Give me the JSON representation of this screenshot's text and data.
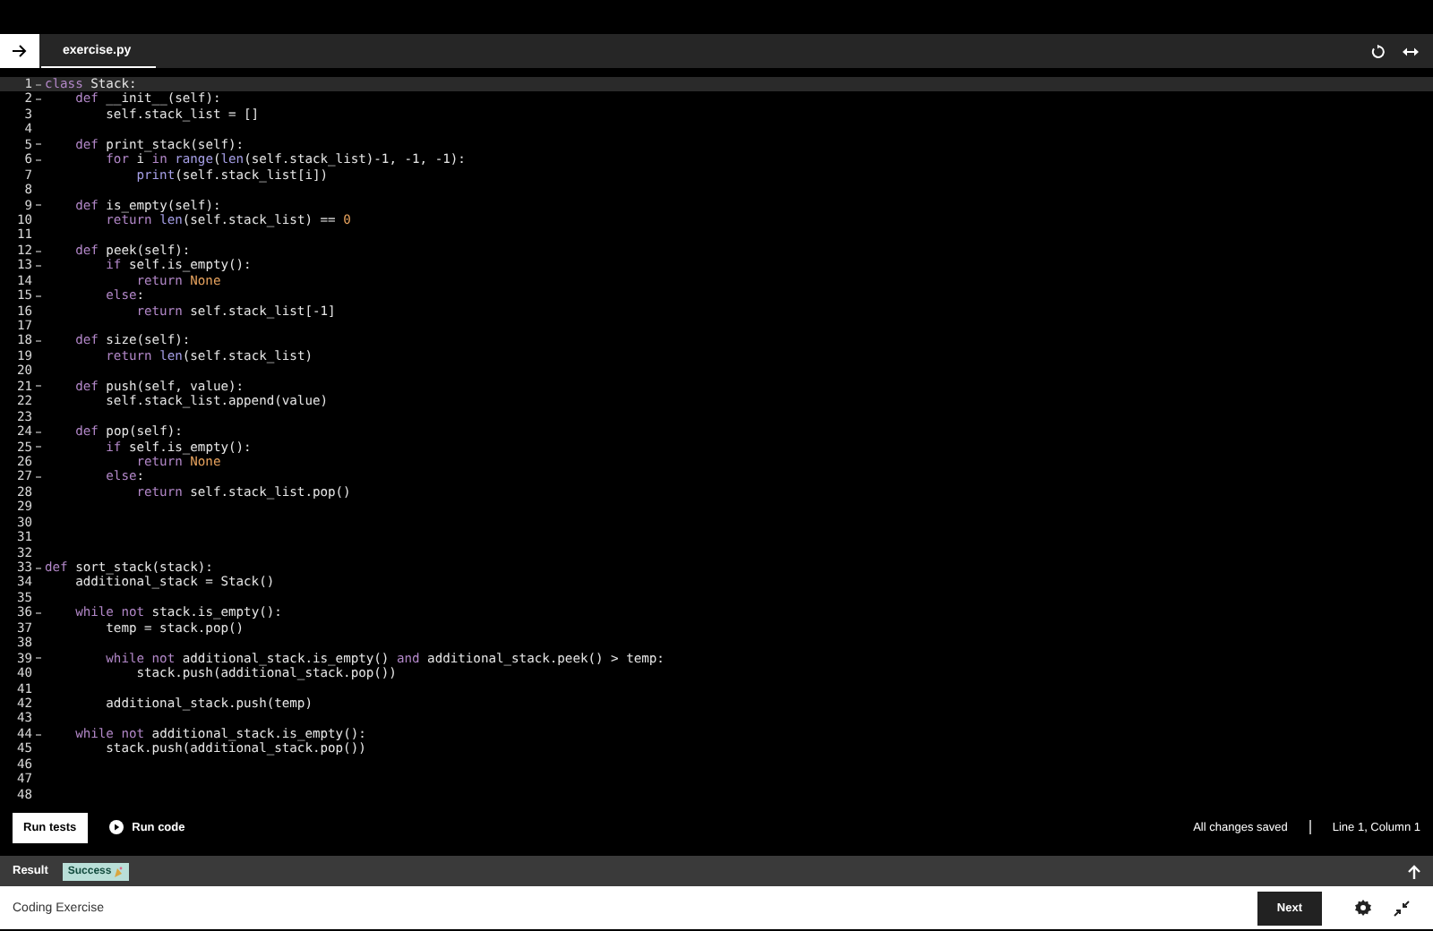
{
  "tab_bar": {
    "file_tab": {
      "label": "exercise.py",
      "selected": true
    }
  },
  "editor": {
    "lines": [
      {
        "number": "1",
        "foldable": true,
        "current": true,
        "tokens": [
          {
            "kind": "keyword",
            "text": "class"
          },
          {
            "kind": "plain",
            "text": " Stack:"
          }
        ]
      },
      {
        "number": "2",
        "foldable": true,
        "current": false,
        "tokens": [
          {
            "kind": "keyword",
            "text": "    def"
          },
          {
            "kind": "plain",
            "text": " __init__(self):"
          }
        ]
      },
      {
        "number": "3",
        "foldable": false,
        "current": false,
        "tokens": [
          {
            "kind": "plain",
            "text": "        self.stack_list = []"
          }
        ]
      },
      {
        "number": "4",
        "foldable": false,
        "current": false
      },
      {
        "number": "5",
        "foldable": true,
        "current": false,
        "tokens": [
          {
            "kind": "keyword",
            "text": "    def"
          },
          {
            "kind": "plain",
            "text": " print_stack(self):"
          }
        ]
      },
      {
        "number": "6",
        "foldable": true,
        "current": false,
        "tokens": [
          {
            "kind": "keyword",
            "text": "        for"
          },
          {
            "kind": "plain",
            "text": " i "
          },
          {
            "kind": "keyword",
            "text": "in"
          },
          {
            "kind": "builtin",
            "text": " range"
          },
          {
            "kind": "plain",
            "text": "("
          },
          {
            "kind": "builtin",
            "text": "len"
          },
          {
            "kind": "plain",
            "text": "(self.stack_list)-1, -1, -1):"
          }
        ]
      },
      {
        "number": "7",
        "foldable": false,
        "current": false,
        "tokens": [
          {
            "kind": "builtin",
            "text": "            print"
          },
          {
            "kind": "plain",
            "text": "(self.stack_list[i])"
          }
        ]
      },
      {
        "number": "8",
        "foldable": false,
        "current": false
      },
      {
        "number": "9",
        "foldable": true,
        "current": false,
        "tokens": [
          {
            "kind": "keyword",
            "text": "    def"
          },
          {
            "kind": "plain",
            "text": " is_empty(self):"
          }
        ]
      },
      {
        "number": "10",
        "foldable": false,
        "current": false,
        "tokens": [
          {
            "kind": "keyword",
            "text": "        return"
          },
          {
            "kind": "builtin",
            "text": " len"
          },
          {
            "kind": "plain",
            "text": "(self.stack_list) == "
          },
          {
            "kind": "constant",
            "text": "0"
          }
        ]
      },
      {
        "number": "11",
        "foldable": false,
        "current": false
      },
      {
        "number": "12",
        "foldable": true,
        "current": false,
        "tokens": [
          {
            "kind": "keyword",
            "text": "    def"
          },
          {
            "kind": "plain",
            "text": " peek(self):"
          }
        ]
      },
      {
        "number": "13",
        "foldable": true,
        "current": false,
        "tokens": [
          {
            "kind": "keyword",
            "text": "        if"
          },
          {
            "kind": "plain",
            "text": " self.is_empty():"
          }
        ]
      },
      {
        "number": "14",
        "foldable": false,
        "current": false,
        "tokens": [
          {
            "kind": "keyword",
            "text": "            return"
          },
          {
            "kind": "constant",
            "text": " None"
          }
        ]
      },
      {
        "number": "15",
        "foldable": true,
        "current": false,
        "tokens": [
          {
            "kind": "keyword",
            "text": "        else"
          },
          {
            "kind": "plain",
            "text": ":"
          }
        ]
      },
      {
        "number": "16",
        "foldable": false,
        "current": false,
        "tokens": [
          {
            "kind": "keyword",
            "text": "            return"
          },
          {
            "kind": "plain",
            "text": " self.stack_list[-1]"
          }
        ]
      },
      {
        "number": "17",
        "foldable": false,
        "current": false
      },
      {
        "number": "18",
        "foldable": true,
        "current": false,
        "tokens": [
          {
            "kind": "keyword",
            "text": "    def"
          },
          {
            "kind": "plain",
            "text": " size(self):"
          }
        ]
      },
      {
        "number": "19",
        "foldable": false,
        "current": false,
        "tokens": [
          {
            "kind": "keyword",
            "text": "        return"
          },
          {
            "kind": "builtin",
            "text": " len"
          },
          {
            "kind": "plain",
            "text": "(self.stack_list)"
          }
        ]
      },
      {
        "number": "20",
        "foldable": false,
        "current": false
      },
      {
        "number": "21",
        "foldable": true,
        "current": false,
        "tokens": [
          {
            "kind": "keyword",
            "text": "    def"
          },
          {
            "kind": "plain",
            "text": " push(self, value):"
          }
        ]
      },
      {
        "number": "22",
        "foldable": false,
        "current": false,
        "tokens": [
          {
            "kind": "plain",
            "text": "        self.stack_list.append(value)"
          }
        ]
      },
      {
        "number": "23",
        "foldable": false,
        "current": false
      },
      {
        "number": "24",
        "foldable": true,
        "current": false,
        "tokens": [
          {
            "kind": "keyword",
            "text": "    def"
          },
          {
            "kind": "plain",
            "text": " pop(self):"
          }
        ]
      },
      {
        "number": "25",
        "foldable": true,
        "current": false,
        "tokens": [
          {
            "kind": "keyword",
            "text": "        if"
          },
          {
            "kind": "plain",
            "text": " self.is_empty():"
          }
        ]
      },
      {
        "number": "26",
        "foldable": false,
        "current": false,
        "tokens": [
          {
            "kind": "keyword",
            "text": "            return"
          },
          {
            "kind": "constant",
            "text": " None"
          }
        ]
      },
      {
        "number": "27",
        "foldable": true,
        "current": false,
        "tokens": [
          {
            "kind": "keyword",
            "text": "        else"
          },
          {
            "kind": "plain",
            "text": ":"
          }
        ]
      },
      {
        "number": "28",
        "foldable": false,
        "current": false,
        "tokens": [
          {
            "kind": "keyword",
            "text": "            return"
          },
          {
            "kind": "plain",
            "text": " self.stack_list.pop()"
          }
        ]
      },
      {
        "number": "29",
        "foldable": false,
        "current": false
      },
      {
        "number": "30",
        "foldable": false,
        "current": false
      },
      {
        "number": "31",
        "foldable": false,
        "current": false
      },
      {
        "number": "32",
        "foldable": false,
        "current": false
      },
      {
        "number": "33",
        "foldable": true,
        "current": false,
        "tokens": [
          {
            "kind": "keyword",
            "text": "def"
          },
          {
            "kind": "plain",
            "text": " sort_stack(stack):"
          }
        ]
      },
      {
        "number": "34",
        "foldable": false,
        "current": false,
        "tokens": [
          {
            "kind": "plain",
            "text": "    additional_stack = Stack()"
          }
        ]
      },
      {
        "number": "35",
        "foldable": false,
        "current": false
      },
      {
        "number": "36",
        "foldable": true,
        "current": false,
        "tokens": [
          {
            "kind": "keyword",
            "text": "    while not"
          },
          {
            "kind": "plain",
            "text": " stack.is_empty():"
          }
        ]
      },
      {
        "number": "37",
        "foldable": false,
        "current": false,
        "tokens": [
          {
            "kind": "plain",
            "text": "        temp = stack.pop()"
          }
        ]
      },
      {
        "number": "38",
        "foldable": false,
        "current": false
      },
      {
        "number": "39",
        "foldable": true,
        "current": false,
        "tokens": [
          {
            "kind": "keyword",
            "text": "        while not"
          },
          {
            "kind": "plain",
            "text": " additional_stack.is_empty() "
          },
          {
            "kind": "keyword",
            "text": "and"
          },
          {
            "kind": "plain",
            "text": " additional_stack.peek() > temp:"
          }
        ]
      },
      {
        "number": "40",
        "foldable": false,
        "current": false,
        "tokens": [
          {
            "kind": "plain",
            "text": "            stack.push(additional_stack.pop())"
          }
        ]
      },
      {
        "number": "41",
        "foldable": false,
        "current": false
      },
      {
        "number": "42",
        "foldable": false,
        "current": false,
        "tokens": [
          {
            "kind": "plain",
            "text": "        additional_stack.push(temp)"
          }
        ]
      },
      {
        "number": "43",
        "foldable": false,
        "current": false
      },
      {
        "number": "44",
        "foldable": true,
        "current": false,
        "tokens": [
          {
            "kind": "keyword",
            "text": "    while not"
          },
          {
            "kind": "plain",
            "text": " additional_stack.is_empty():"
          }
        ]
      },
      {
        "number": "45",
        "foldable": false,
        "current": false,
        "tokens": [
          {
            "kind": "plain",
            "text": "        stack.push(additional_stack.pop())"
          }
        ]
      },
      {
        "number": "46",
        "foldable": false,
        "current": false
      },
      {
        "number": "47",
        "foldable": false,
        "current": false
      },
      {
        "number": "48",
        "foldable": false,
        "current": false
      }
    ]
  },
  "toolbar": {
    "run_tests": "Run tests",
    "run_code": "Run code",
    "save_status": "All changes saved",
    "cursor_position": "Line 1, Column 1"
  },
  "result_bar": {
    "label": "Result",
    "status": "Success"
  },
  "footer": {
    "title": "Coding Exercise",
    "next": "Next"
  }
}
